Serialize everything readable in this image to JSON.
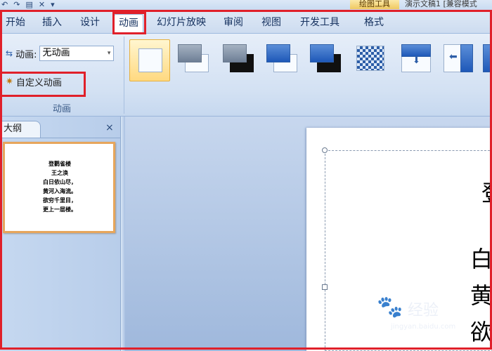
{
  "title_bar": {
    "qat_icons": [
      "undo-icon",
      "redo-icon",
      "print-preview-icon",
      "close-icon",
      "dropdown-icon"
    ],
    "context_tab": "绘图工具",
    "doc_title": "演示文稿1 [兼容模式"
  },
  "tabs": [
    {
      "label": "开始"
    },
    {
      "label": "插入"
    },
    {
      "label": "设计"
    },
    {
      "label": "动画",
      "active": true
    },
    {
      "label": "幻灯片放映"
    },
    {
      "label": "审阅"
    },
    {
      "label": "视图"
    },
    {
      "label": "开发工具"
    },
    {
      "label": "格式"
    }
  ],
  "ribbon": {
    "animation_label": "动画:",
    "animation_value": "无动画",
    "custom_animation_label": "自定义动画",
    "group_label": "动画"
  },
  "left_panel": {
    "tab_label": "大纲",
    "close_label": "×",
    "thumbnail_lines": [
      "登鹳雀楼",
      "王之涣",
      "白日依山尽，",
      "黄河入海流。",
      "欲穷千里目，",
      "更上一层楼。"
    ]
  },
  "slide": {
    "visible_chars": [
      "登",
      "白",
      "黄",
      "欲"
    ]
  },
  "watermark": {
    "text": "经验",
    "url": "jingyan.baidu.com"
  },
  "colors": {
    "annotation_red": "#e0202a",
    "thumbnail_border": "#e7a65c",
    "ribbon_bg": "#d3e1f3"
  }
}
